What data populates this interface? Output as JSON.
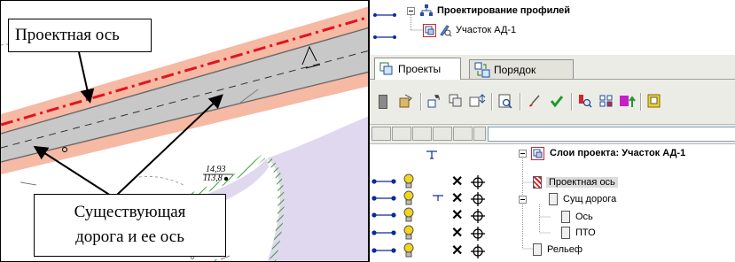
{
  "map": {
    "callouts": {
      "design_axis": "Проектная ось",
      "existing_road_line1": "Существующая",
      "existing_road_line2": "дорога и ее ось"
    },
    "elevation": {
      "top": "14,93",
      "bottom": "113,8"
    },
    "colors": {
      "road": "#c8c8c8",
      "shoulder": "#f5b9a4",
      "axis": "#e0141e",
      "lawn": "#e0d8ee",
      "hatch": "#3f9a3c"
    }
  },
  "app": {
    "project_tree": {
      "root": {
        "label": "Проектирование профилей",
        "icon": "hierarchy-icon"
      },
      "child": {
        "label": "Участок АД-1",
        "icons": [
          "profile-section-icon",
          "pencil-search-icon"
        ]
      }
    },
    "tabs": [
      {
        "label": "Проекты",
        "active": true,
        "icon": "projects-icon"
      },
      {
        "label": "Порядок",
        "active": false,
        "icon": "order-icon"
      }
    ],
    "toolbar": [
      "layer-icon",
      "open-folder-icon",
      "copy-attributes-icon",
      "duplicate-icon",
      "move-layer-icon",
      "inspect-icon",
      "brush-icon",
      "checkmark-icon",
      "select-object-icon",
      "grid-icon",
      "color-layer-icon",
      "properties-icon"
    ],
    "layers": {
      "root": {
        "label": "Слои проекта: Участок АД-1"
      },
      "items": [
        {
          "label": "Проектная ось",
          "selected": true
        },
        {
          "label": "Сущ дорога"
        },
        {
          "label": "Ось"
        },
        {
          "label": "ПТО"
        },
        {
          "label": "Рельеф"
        }
      ]
    },
    "colors": {
      "panel_bg": "#ecece6",
      "connector": "#0a2a9c",
      "lightbulb": "#f2d51a",
      "accent": "#d8212a"
    }
  }
}
